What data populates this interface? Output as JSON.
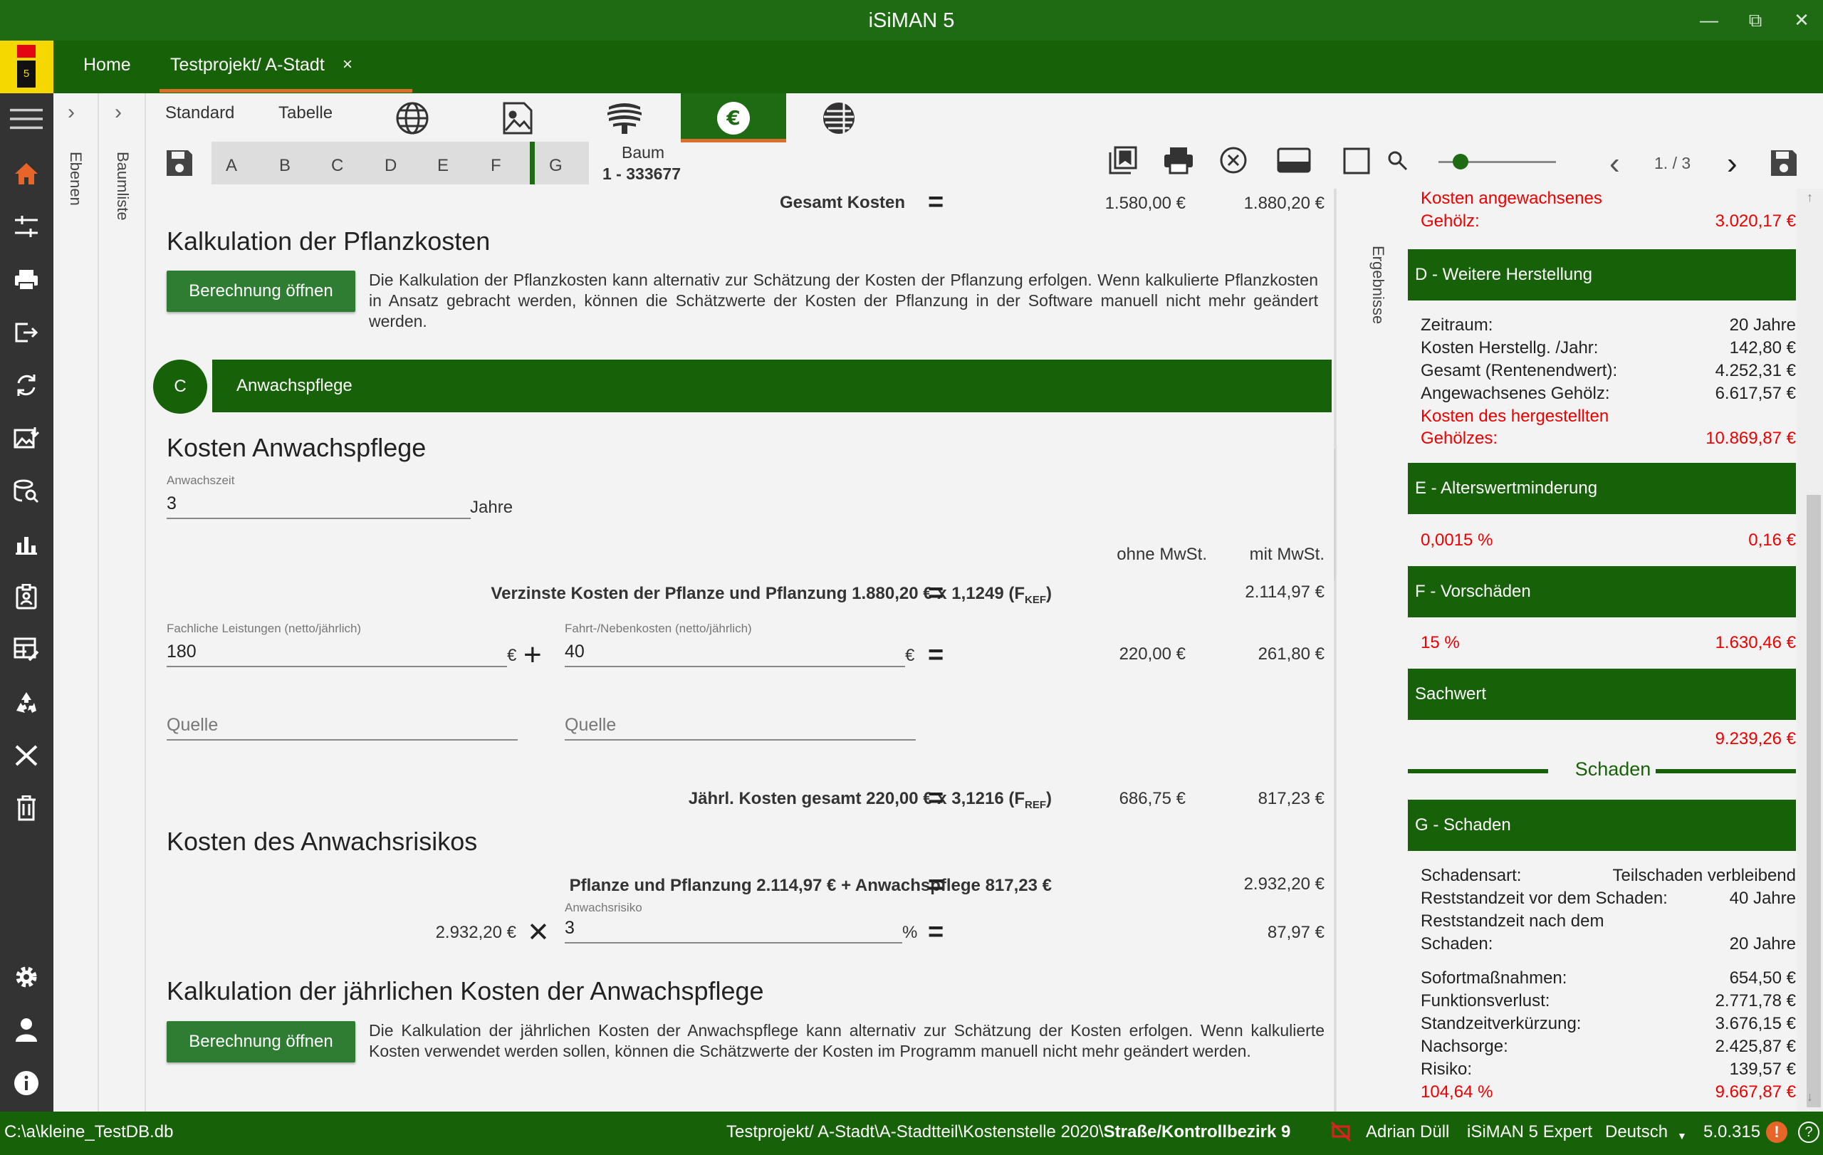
{
  "window": {
    "title": "iSiMAN 5"
  },
  "tabs": {
    "home": "Home",
    "project": "Testprojekt/ A-Stadt",
    "close": "×"
  },
  "sidebar_labels": {
    "ebenen": "Ebenen",
    "baumliste": "Baumliste"
  },
  "toolbar": {
    "view_tabs": [
      "Standard",
      "Tabelle"
    ],
    "sections": [
      "A",
      "B",
      "C",
      "D",
      "E",
      "F",
      "G"
    ],
    "baum_label": "Baum",
    "baum_id": "1 - 333677",
    "page": "1. / 3"
  },
  "main": {
    "top_total": {
      "label": "Gesamt Kosten",
      "ohne": "1.580,00 €",
      "mit": "1.880,20 €"
    },
    "pflanz": {
      "heading": "Kalkulation der Pflanzkosten",
      "button": "Berechnung öffnen",
      "text": "Die Kalkulation der Pflanzkosten kann alternativ zur Schätzung der Kosten der Pflanzung erfolgen. Wenn kalkulierte Pflanzkosten in Ansatz gebracht werden, können die Schätzwerte der Kosten der Pflanzung in der Software manuell nicht mehr geändert werden."
    },
    "section_c": {
      "badge": "C",
      "title": "Anwachspflege"
    },
    "anwachs": {
      "heading": "Kosten Anwachspflege",
      "zeit_label": "Anwachszeit",
      "zeit_value": "3",
      "zeit_unit": "Jahre",
      "col_ohne": "ohne MwSt.",
      "col_mit": "mit MwSt.",
      "verzinst_label": "Verzinste Kosten der Pflanze und Pflanzung 1.880,20 € x 1,1249 (F",
      "verzinst_sub": "KEF",
      "verzinst_mit": "2.114,97 €",
      "fach_label": "Fachliche Leistungen (netto/jährlich)",
      "fach_value": "180",
      "fahrt_label": "Fahrt-/Nebenkosten (netto/jährlich)",
      "fahrt_value": "40",
      "currency": "€",
      "row_ohne": "220,00 €",
      "row_mit": "261,80 €",
      "quelle1": "Quelle",
      "quelle2": "Quelle",
      "jaehrl_label": "Jährl. Kosten gesamt 220,00 € x 3,1216 (F",
      "jaehrl_sub": "REF",
      "jaehrl_ohne": "686,75 €",
      "jaehrl_mit": "817,23 €"
    },
    "risiko": {
      "heading": "Kosten des Anwachsrisikos",
      "sum_label": "Pflanze und Pflanzung 2.114,97 € + Anwachspflege 817,23 €",
      "sum_mit": "2.932,20 €",
      "base": "2.932,20 €",
      "risk_label": "Anwachsrisiko",
      "risk_value": "3",
      "risk_unit": "%",
      "result": "87,97 €"
    },
    "jaehrlich": {
      "heading": "Kalkulation der jährlichen Kosten der Anwachspflege",
      "button": "Berechnung öffnen",
      "text": "Die Kalkulation der jährlichen Kosten der Anwachspflege kann alternativ zur Schätzung der Kosten erfolgen. Wenn kalkulierte Kosten verwendet werden sollen, können die Schätzwerte der Kosten im Programm manuell nicht mehr geändert werden."
    }
  },
  "results": {
    "vertical_label": "Ergebnisse",
    "top": {
      "l1": "Kosten angewachsenes",
      "l2": "Gehölz:",
      "value": "3.020,17 €"
    },
    "d": {
      "title": "D - Weitere Herstellung",
      "rows": [
        {
          "label": "Zeitraum:",
          "value": "20 Jahre"
        },
        {
          "label": "Kosten Herstellg. /Jahr:",
          "value": "142,80 €"
        },
        {
          "label": "Gesamt (Rentenendwert):",
          "value": "4.252,31 €"
        },
        {
          "label": "Angewachsenes Gehölz:",
          "value": "6.617,57 €"
        }
      ],
      "total_l1": "Kosten des hergestellten",
      "total_l2": "Gehölzes:",
      "total_value": "10.869,87 €"
    },
    "e": {
      "title": "E - Alterswertminderung",
      "left": "0,0015 %",
      "right": "0,16 €"
    },
    "f": {
      "title": "F - Vorschäden",
      "left": "15 %",
      "right": "1.630,46 €"
    },
    "sachwert": {
      "title": "Sachwert",
      "value": "9.239,26 €"
    },
    "schaden_divider": "Schaden",
    "g": {
      "title": "G - Schaden",
      "art_label": "Schadensart:",
      "art_value": "Teilschaden verbleibend",
      "rest_vor_label": "Reststandzeit vor dem Schaden:",
      "rest_vor_value": "40 Jahre",
      "rest_nach_l1": "Reststandzeit nach dem",
      "rest_nach_l2": "Schaden:",
      "rest_nach_value": "20 Jahre",
      "rows": [
        {
          "label": "Sofortmaßnahmen:",
          "value": "654,50 €"
        },
        {
          "label": "Funktionsverlust:",
          "value": "2.771,78 €"
        },
        {
          "label": "Standzeitverkürzung:",
          "value": "3.676,15 €"
        },
        {
          "label": "Nachsorge:",
          "value": "2.425,87 €"
        },
        {
          "label": "Risiko:",
          "value": "139,57 €"
        }
      ],
      "total_left": "104,64 %",
      "total_right": "9.667,87 €"
    }
  },
  "statusbar": {
    "db": "C:\\a\\kleine_TestDB.db",
    "path": "Testprojekt/ A-Stadt\\A-Stadtteil\\Kostenstelle 2020\\",
    "path_bold": "Straße/Kontrollbezirk 9",
    "user": "Adrian Düll",
    "edition": "iSiMAN 5 Expert",
    "language": "Deutsch",
    "version": "5.0.315"
  },
  "colors": {
    "primary_green": "#176208",
    "button_green": "#2e7d32",
    "accent_orange": "#d96f2a",
    "alert_red": "#e00000"
  }
}
